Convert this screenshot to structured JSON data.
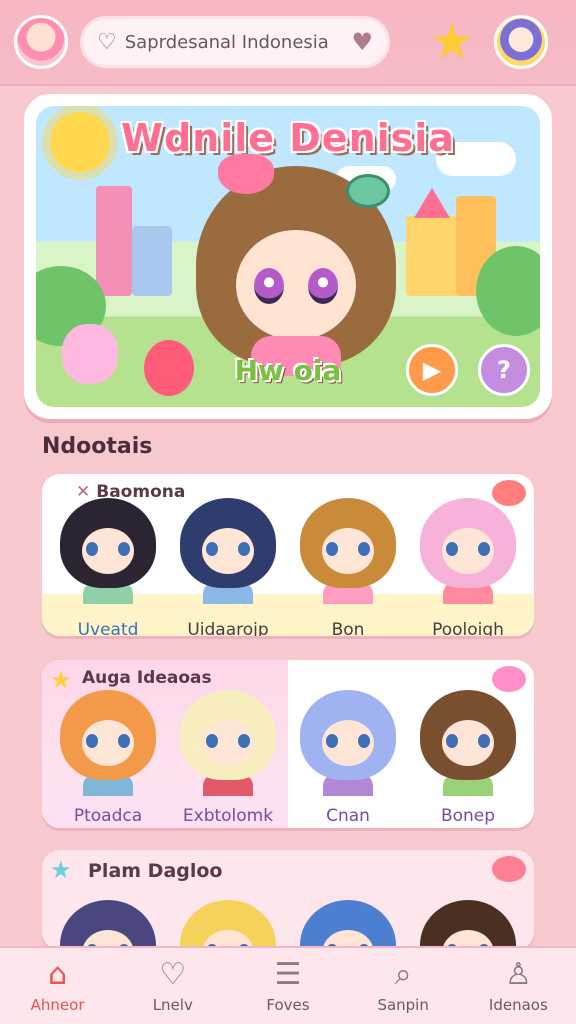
{
  "header": {
    "search_placeholder": "Saprdesanal Indonesia"
  },
  "hero": {
    "title": "Wdnile Denisia",
    "subtitle": "Hw oia"
  },
  "section": {
    "title": "Ndootais"
  },
  "rows": [
    {
      "label": "Baomona",
      "characters": [
        {
          "name": "Uveatd",
          "hair": "#2c2433",
          "body": "#8fd0a6"
        },
        {
          "name": "Uidaarojp",
          "hair": "#2f3d6e",
          "body": "#8ab6e8"
        },
        {
          "name": "Bon",
          "hair": "#c98a3a",
          "body": "#ff9ec2"
        },
        {
          "name": "Pooloigh",
          "hair": "#f7b2d9",
          "body": "#ff8a9e"
        }
      ]
    },
    {
      "label": "Auga Ideaoas",
      "characters": [
        {
          "name": "Ptoadca",
          "hair": "#f29a4a",
          "body": "#7fb7d8"
        },
        {
          "name": "Exbtolomk",
          "hair": "#f7efc0",
          "body": "#e25a6a"
        },
        {
          "name": "Cnan",
          "hair": "#9fb2f2",
          "body": "#b388d6"
        },
        {
          "name": "Bonep",
          "hair": "#7a4f30",
          "body": "#9ad27a"
        }
      ]
    },
    {
      "label": "Plam Dagloo",
      "characters": [
        {
          "name": "",
          "hair": "#4a4680",
          "body": "#c8c0ea"
        },
        {
          "name": "",
          "hair": "#f5d25a",
          "body": "#ffcf8a"
        },
        {
          "name": "",
          "hair": "#4d7fd0",
          "body": "#8ac0f0"
        },
        {
          "name": "",
          "hair": "#4a2f22",
          "body": "#f08a6a"
        }
      ]
    }
  ],
  "nav": [
    {
      "label": "Ahneor",
      "icon": "home-icon",
      "glyph": "⌂",
      "active": true
    },
    {
      "label": "Lnelv",
      "icon": "heart-icon",
      "glyph": "♡",
      "active": false
    },
    {
      "label": "Foves",
      "icon": "list-icon",
      "glyph": "☰",
      "active": false
    },
    {
      "label": "Sanpin",
      "icon": "search-icon",
      "glyph": "⌕",
      "active": false
    },
    {
      "label": "Idenaos",
      "icon": "user-icon",
      "glyph": "♙",
      "active": false
    }
  ],
  "colors": {
    "accent": "#e8544f",
    "background": "#f7c9cf"
  }
}
